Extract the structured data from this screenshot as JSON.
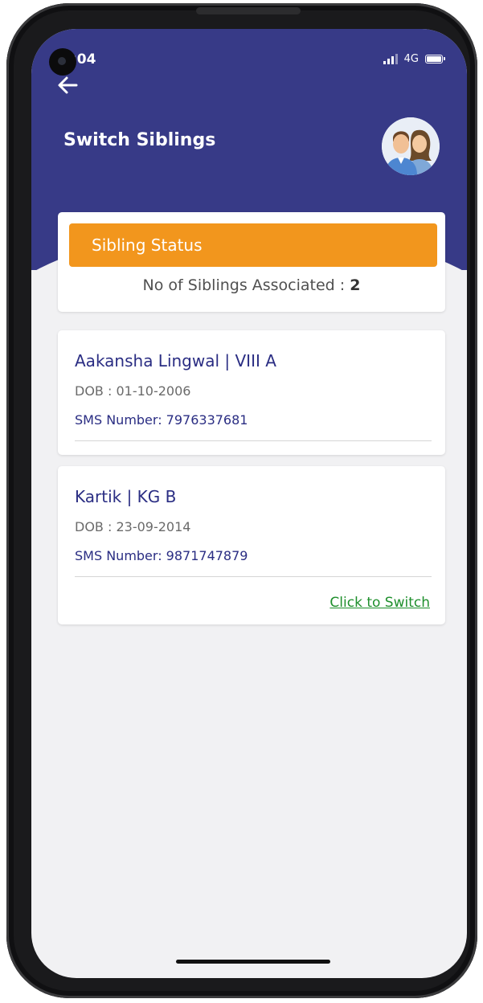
{
  "status_bar": {
    "time": ":04",
    "network": "4G"
  },
  "header": {
    "title": "Switch Siblings",
    "back_icon": "arrow-left-icon",
    "avatar_icon": "siblings-avatar-icon",
    "background_color": "#373a87"
  },
  "sibling_status": {
    "banner_label": "Sibling Status",
    "banner_color": "#f2961d",
    "associated_label": "No of Siblings Associated : ",
    "associated_count": "2"
  },
  "siblings": [
    {
      "name_class": "Aakansha  Lingwal | VIII A",
      "dob": "DOB : 01-10-2006",
      "sms": "SMS Number: 7976337681"
    },
    {
      "name_class": "Kartik   | KG B",
      "dob": "DOB : 23-09-2014",
      "sms": "SMS Number: 9871747879",
      "action_label": "Click to Switch"
    }
  ],
  "colors": {
    "name_text": "#2a2d83",
    "switch_link": "#1e8f2c"
  }
}
